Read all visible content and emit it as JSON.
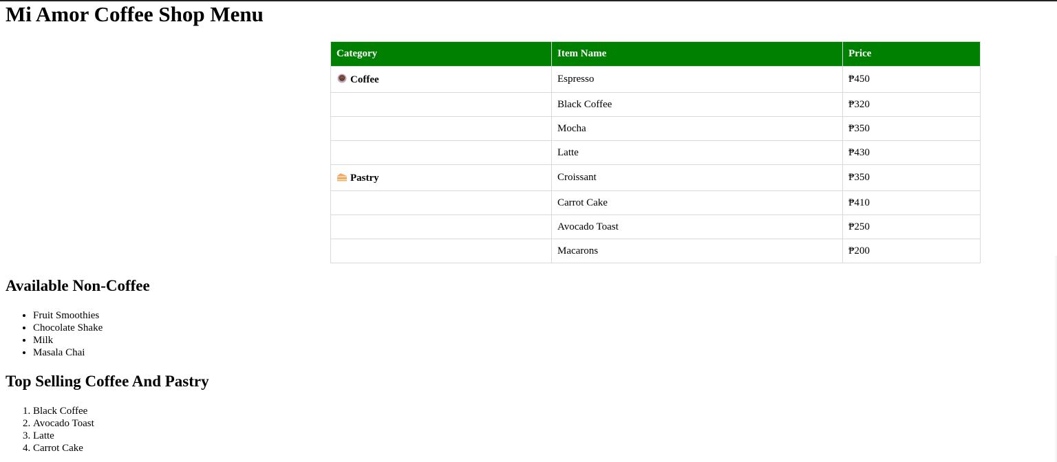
{
  "page_title": "Mi Amor Coffee Shop Menu",
  "table": {
    "headers": [
      "Category",
      "Item Name",
      "Price"
    ],
    "categories": [
      {
        "label": "Coffee",
        "icon": "coffee-icon"
      },
      {
        "label": "Pastry",
        "icon": "cake-icon"
      }
    ],
    "rows": [
      {
        "item": "Espresso",
        "price": "₱450"
      },
      {
        "item": "Black Coffee",
        "price": "₱320"
      },
      {
        "item": "Mocha",
        "price": "₱350"
      },
      {
        "item": "Latte",
        "price": "₱430"
      },
      {
        "item": "Croissant",
        "price": "₱350"
      },
      {
        "item": "Carrot Cake",
        "price": "₱410"
      },
      {
        "item": "Avocado Toast",
        "price": "₱250"
      },
      {
        "item": "Macarons",
        "price": "₱200"
      }
    ],
    "header_color": "#008000"
  },
  "non_coffee": {
    "heading": "Available Non-Coffee",
    "items": [
      "Fruit Smoothies",
      "Chocolate Shake",
      "Milk",
      "Masala Chai"
    ]
  },
  "top_selling": {
    "heading": "Top Selling Coffee And Pastry",
    "items": [
      "Black Coffee",
      "Avocado Toast",
      "Latte",
      "Carrot Cake"
    ]
  }
}
